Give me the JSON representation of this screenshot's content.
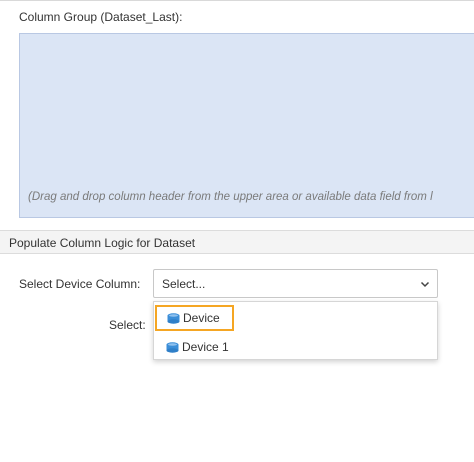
{
  "column_group": {
    "label": "Column Group (Dataset_Last):",
    "drop_hint": "(Drag and drop column header from the upper area or available data field from l"
  },
  "populate_section": {
    "title": "Populate Column Logic for Dataset"
  },
  "device_column": {
    "label": "Select Device Column:",
    "selected_value": "Select..."
  },
  "select_row": {
    "label": "Select:"
  },
  "dropdown": {
    "options": [
      {
        "label": "Device",
        "icon": "database-icon",
        "highlighted": true
      },
      {
        "label": "Device 1",
        "icon": "database-icon",
        "highlighted": false
      }
    ]
  },
  "colors": {
    "drop_zone_bg": "#dbe5f5",
    "highlight_border": "#f5a623",
    "db_icon": "#3b8ed8"
  }
}
